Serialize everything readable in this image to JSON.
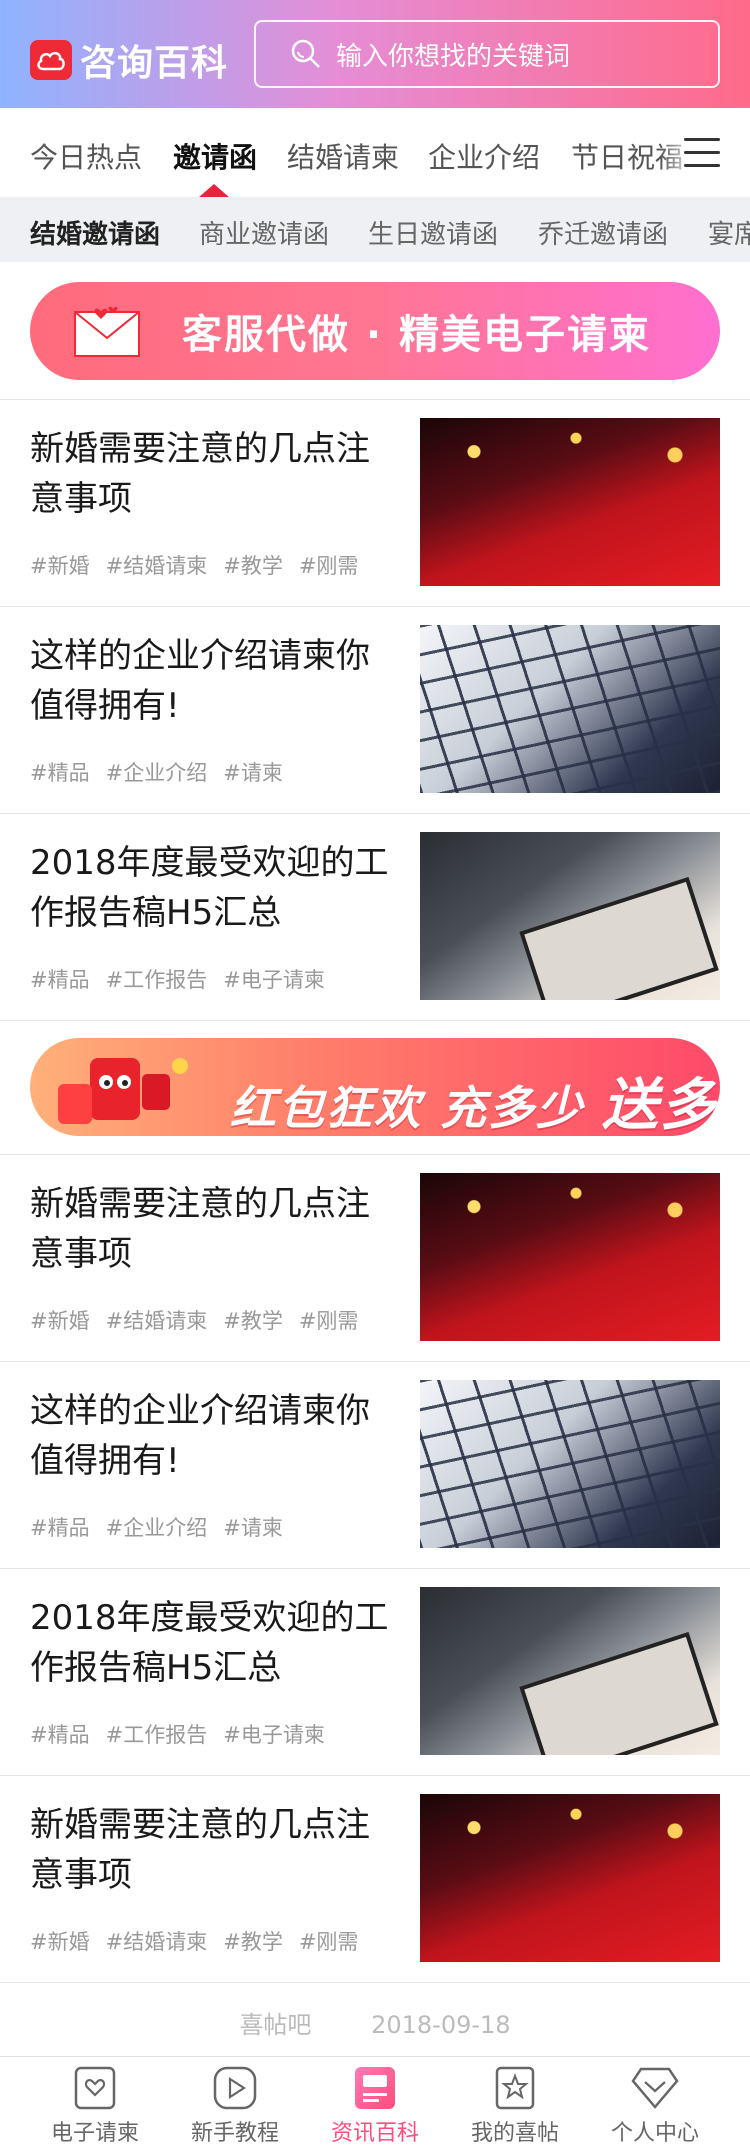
{
  "header": {
    "app_name": "咨询百科",
    "search_placeholder": "输入你想找的关键词"
  },
  "tabs": [
    "今日热点",
    "邀请函",
    "结婚请柬",
    "企业介绍",
    "节日祝福"
  ],
  "active_tab": "邀请函",
  "subtabs": [
    "结婚邀请函",
    "商业邀请函",
    "生日邀请函",
    "乔迁邀请函",
    "宴席邀请函"
  ],
  "banner_top": {
    "text": "客服代做 · 精美电子请柬"
  },
  "banner_mid": {
    "text_a": "红包狂欢",
    "text_b": "充多少",
    "text_c": "送多少"
  },
  "articles": [
    {
      "title": "新婚需要注意的几点注意事项",
      "tags": [
        "#新婚",
        "#结婚请柬",
        "#教学",
        "#刚需"
      ],
      "image": "wedding-photo"
    },
    {
      "title": "这样的企业介绍请柬你值得拥有!",
      "tags": [
        "#精品",
        "#企业介绍",
        "#请柬"
      ],
      "image": "building-photo"
    },
    {
      "title": "2018年度最受欢迎的工作报告稿H5汇总",
      "tags": [
        "#精品",
        "#工作报告",
        "#电子请柬"
      ],
      "image": "tablet-photo"
    },
    {
      "title": "新婚需要注意的几点注意事项",
      "tags": [
        "#新婚",
        "#结婚请柬",
        "#教学",
        "#刚需"
      ],
      "image": "wedding-photo"
    },
    {
      "title": "这样的企业介绍请柬你值得拥有!",
      "tags": [
        "#精品",
        "#企业介绍",
        "#请柬"
      ],
      "image": "building-photo"
    },
    {
      "title": "2018年度最受欢迎的工作报告稿H5汇总",
      "tags": [
        "#精品",
        "#工作报告",
        "#电子请柬"
      ],
      "image": "tablet-photo"
    },
    {
      "title": "新婚需要注意的几点注意事项",
      "tags": [
        "#新婚",
        "#结婚请柬",
        "#教学",
        "#刚需"
      ],
      "image": "wedding-photo"
    }
  ],
  "footer": {
    "site": "喜帖吧",
    "date": "2018-09-18"
  },
  "bottom_nav": [
    {
      "label": "电子请柬",
      "icon": "invitation-icon"
    },
    {
      "label": "新手教程",
      "icon": "play-icon"
    },
    {
      "label": "资讯百科",
      "icon": "news-icon"
    },
    {
      "label": "我的喜帖",
      "icon": "star-card-icon"
    },
    {
      "label": "个人中心",
      "icon": "user-diamond-icon"
    }
  ],
  "active_nav": "资讯百科",
  "colors": {
    "accent": "#ff4b7d",
    "tab_indicator": "#e8233b",
    "logo": "#ee2a37"
  }
}
